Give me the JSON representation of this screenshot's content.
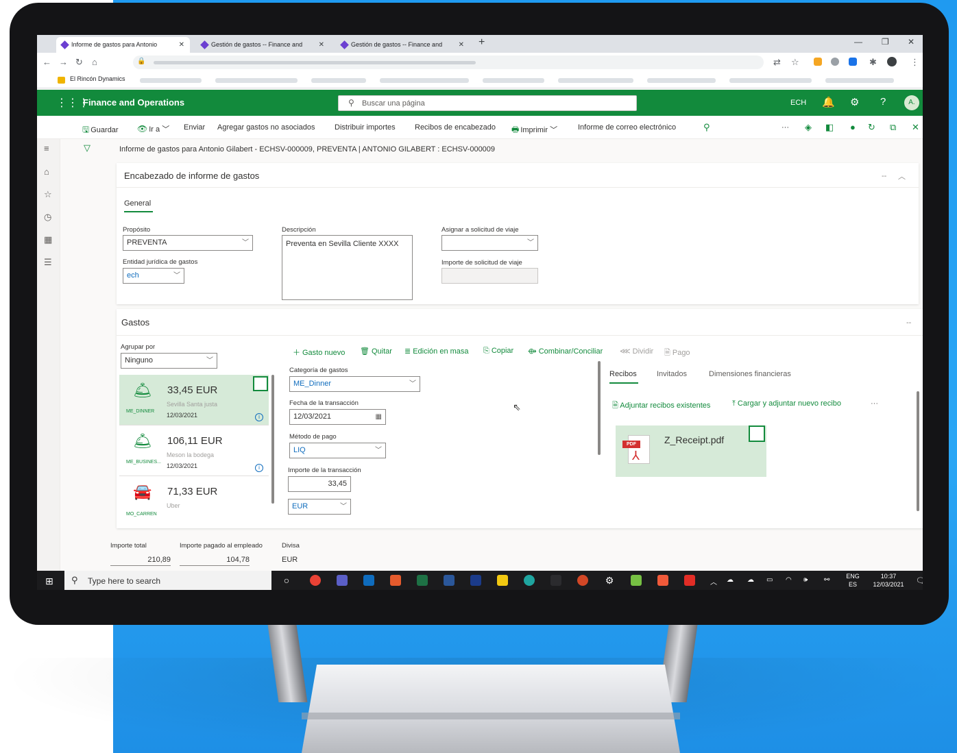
{
  "colors": {
    "d365_green": "#128a3c",
    "selected_row": "#d6ead8",
    "link_blue": "#0f6cbd",
    "backdrop_blue": "#1f9af0"
  },
  "browser": {
    "tabs": [
      {
        "label": "Informe de gastos para Antonio",
        "icon": "dynamics-diamond-icon"
      },
      {
        "label": "Gestión de gastos -- Finance and",
        "icon": "dynamics-diamond-icon"
      },
      {
        "label": "Gestión de gastos -- Finance and",
        "icon": "dynamics-diamond-icon"
      }
    ],
    "close_glyph": "✕",
    "new_tab": "+",
    "bookmark": "El Rincón Dynamics"
  },
  "header": {
    "app_name": "Finance and Operations",
    "search_placeholder": "Buscar una página",
    "company": "ECH",
    "avatar": "A."
  },
  "actions": {
    "save": "Guardar",
    "goto": "Ir a",
    "send": "Enviar",
    "add_unattached": "Agregar gastos no asociados",
    "distribute": "Distribuir importes",
    "header_receipts": "Recibos de encabezado",
    "print": "Imprimir",
    "email_report": "Informe de correo electrónico",
    "more": "···"
  },
  "caption": "Informe de gastos para Antonio Gilabert - ECHSV-000009, PREVENTA  |  ANTONIO GILABERT : ECHSV-000009",
  "header_section": {
    "title": "Encabezado de informe de gastos",
    "tab": "General",
    "purpose_label": "Propósito",
    "purpose_value": "PREVENTA",
    "legal_entity_label": "Entidad jurídica de gastos",
    "legal_entity_value": "ech",
    "description_label": "Descripción",
    "description_value": "Preventa en Sevilla Cliente XXXX",
    "travel_request_label": "Asignar a solicitud de viaje",
    "travel_amount_label": "Importe de solicitud de viaje"
  },
  "expenses_section": {
    "title": "Gastos",
    "group_by_label": "Agrupar por",
    "group_by_value": "Ninguno",
    "items": [
      {
        "amount": "33,45 EUR",
        "merchant": "Sevilla Santa justa",
        "date": "12/03/2021",
        "code": "ME_DINNER"
      },
      {
        "amount": "106,11 EUR",
        "merchant": "Meson la bodega",
        "date": "12/03/2021",
        "code": "ME_BUSINES..."
      },
      {
        "amount": "71,33 EUR",
        "merchant": "Uber",
        "date": "",
        "code": "MO_CARREN"
      }
    ],
    "commands": {
      "new": "Gasto nuevo",
      "remove": "Quitar",
      "mass_edit": "Edición en masa",
      "copy": "Copiar",
      "merge": "Combinar/Conciliar",
      "split": "Dividir",
      "payment": "Pago"
    },
    "detail": {
      "category_label": "Categoría de gastos",
      "category_value": "ME_Dinner",
      "date_label": "Fecha de la transacción",
      "date_value": "12/03/2021",
      "payment_label": "Método de pago",
      "payment_value": "LIQ",
      "amount_label": "Importe de la transacción",
      "amount_value": "33,45",
      "currency_value": "EUR"
    },
    "right_tabs": {
      "receipts": "Recibos",
      "guests": "Invitados",
      "dimensions": "Dimensiones financieras"
    },
    "receipt_commands": {
      "attach_existing": "Adjuntar recibos existentes",
      "upload_new": "Cargar y adjuntar nuevo recibo",
      "more": "···"
    },
    "receipt_file": "Z_Receipt.pdf",
    "pdf_tag": "PDF"
  },
  "totals": {
    "total_label": "Importe total",
    "total_value": "210,89",
    "paid_label": "Importe pagado al empleado",
    "paid_value": "104,78",
    "currency_label": "Divisa",
    "currency_value": "EUR"
  },
  "taskbar": {
    "search_placeholder": "Type here to search",
    "lang_top": "ENG",
    "lang_bottom": "ES",
    "time": "10:37",
    "date": "12/03/2021"
  }
}
